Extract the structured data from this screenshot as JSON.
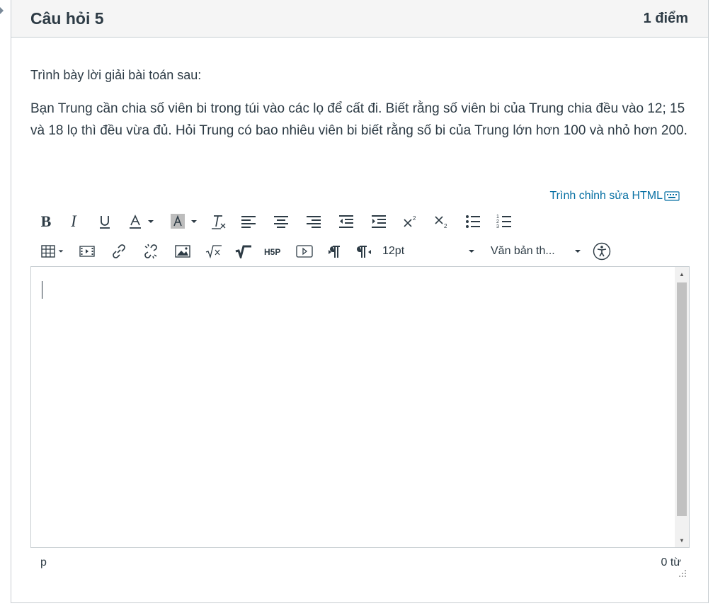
{
  "question": {
    "title": "Câu hỏi 5",
    "points": "1 điểm",
    "prompt": "Trình bày lời giải bài toán sau:",
    "problem": "Bạn Trung cần chia số viên bi trong túi vào các lọ để cất đi. Biết rằng số viên bi của Trung chia đều vào 12; 15 và 18 lọ thì đều vừa đủ. Hỏi Trung có bao nhiêu viên bi biết rằng số bi của Trung lớn hơn 100 và nhỏ hơn 200."
  },
  "editor": {
    "html_editor_link": "Trình chỉnh sửa HTML",
    "font_size": "12pt",
    "format": "Văn bản th...",
    "status_path": "p",
    "word_count": "0 từ",
    "content": ""
  },
  "toolbar": {
    "bold": "B",
    "italic": "I",
    "font_size_caret": "▾",
    "format_caret": "▾"
  }
}
